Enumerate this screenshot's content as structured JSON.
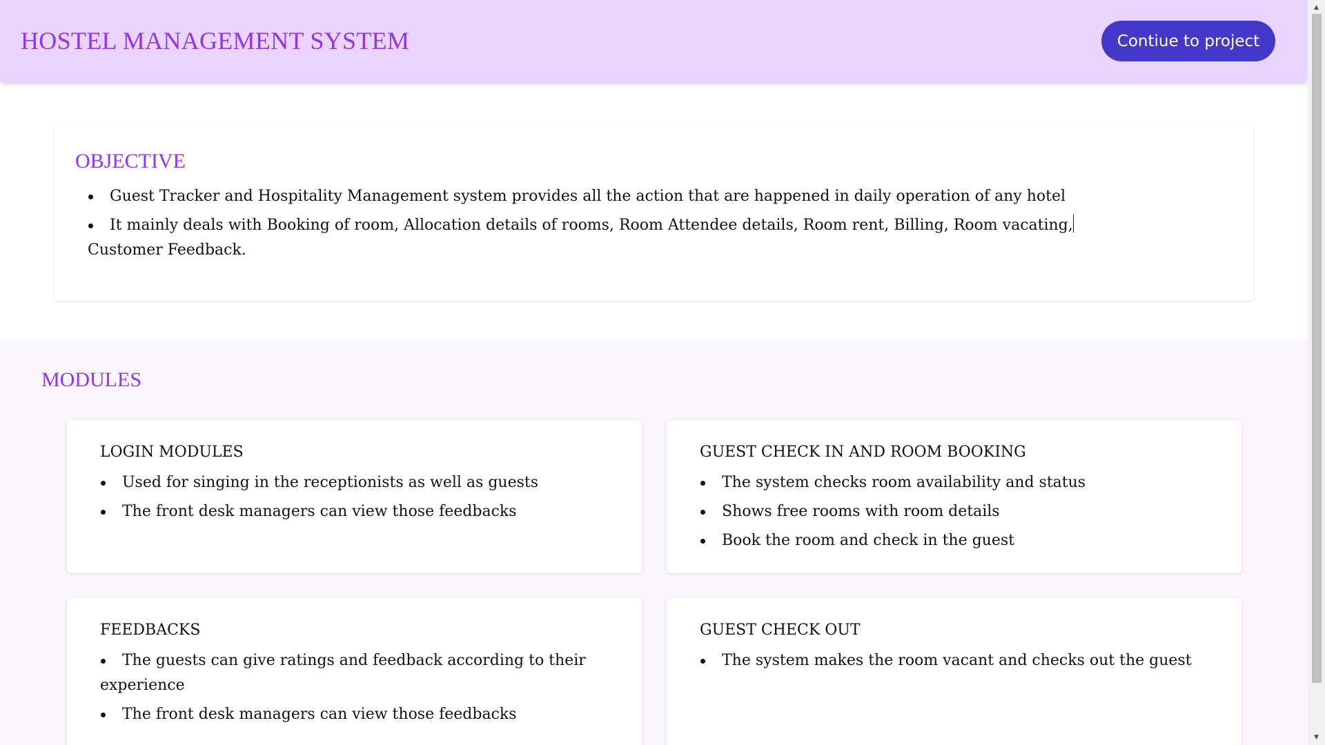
{
  "header": {
    "title": "HOSTEL MANAGEMENT SYSTEM",
    "button_label": "Contiue to project"
  },
  "objective": {
    "title": "OBJECTIVE",
    "items": [
      "Guest Tracker and Hospitality Management system provides all the action that are happened in daily operation of any hotel",
      "It mainly deals with Booking of room, Allocation details of rooms, Room Attendee details, Room rent, Billing, Room vacating,"
    ],
    "continuation": "Customer Feedback."
  },
  "modules": {
    "title": "MODULES",
    "cards": [
      {
        "title": "LOGIN MODULES",
        "items": [
          "Used for singing in the receptionists as well as guests",
          "The front desk managers can view those feedbacks"
        ]
      },
      {
        "title": "GUEST CHECK IN AND ROOM BOOKING",
        "items": [
          "The system checks room availability and status",
          "Shows free rooms with room details",
          "Book the room and check in the guest"
        ]
      },
      {
        "title": "FEEDBACKS",
        "items": [
          "The guests can give ratings and feedback according to their experience",
          "The front desk managers can view those feedbacks"
        ]
      },
      {
        "title": "GUEST CHECK OUT",
        "items": [
          "The system makes the room vacant and checks out the guest"
        ]
      }
    ]
  },
  "scrollbar": {
    "up_icon": "triangle-up",
    "down_icon": "triangle-down"
  }
}
